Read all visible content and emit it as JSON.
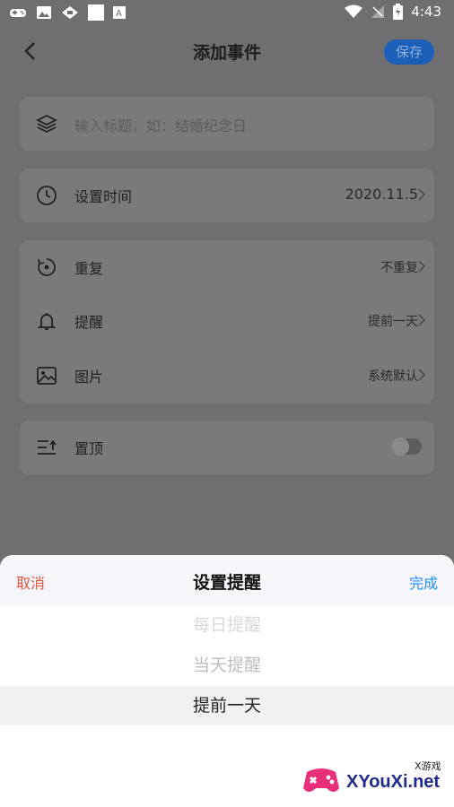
{
  "statusbar": {
    "time": "4:43"
  },
  "appbar": {
    "title": "添加事件",
    "save_label": "保存"
  },
  "title_input": {
    "placeholder": "输入标题，如：结婚纪念日"
  },
  "time_row": {
    "label": "设置时间",
    "value": "2020.11.5"
  },
  "repeat_row": {
    "label": "重复",
    "value": "不重复"
  },
  "reminder_row": {
    "label": "提醒",
    "value": "提前一天"
  },
  "image_row": {
    "label": "图片",
    "value": "系统默认"
  },
  "pin_row": {
    "label": "置顶",
    "toggle_on": false
  },
  "sheet": {
    "cancel_label": "取消",
    "title": "设置提醒",
    "done_label": "完成",
    "options": [
      "每日提醒",
      "当天提醒",
      "提前一天"
    ],
    "selected": "提前一天"
  },
  "watermark": {
    "text": "XYouXi.net",
    "small": "X游戏"
  },
  "colors": {
    "accent": "#1e90ff",
    "cancel": "#e0553f",
    "save_bg": "#1c5fb8"
  }
}
